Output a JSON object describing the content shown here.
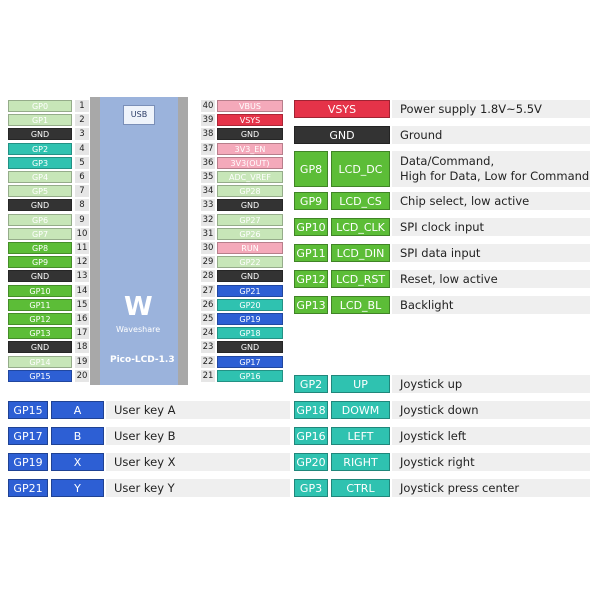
{
  "colors": {
    "lightgreen": "#c7e6b8",
    "dark": "#333333",
    "teal": "#2fc2b0",
    "green": "#5cbd37",
    "blue": "#2d5fd4",
    "pink": "#f4a9ba",
    "red": "#e53349"
  },
  "board": {
    "usb_label": "USB",
    "brand": "Waveshare",
    "model": "Pico-LCD-1.3"
  },
  "left_pins": [
    {
      "num": "1",
      "label": "GP0",
      "color": "lightgreen"
    },
    {
      "num": "2",
      "label": "GP1",
      "color": "lightgreen"
    },
    {
      "num": "3",
      "label": "GND",
      "color": "dark"
    },
    {
      "num": "4",
      "label": "GP2",
      "color": "teal"
    },
    {
      "num": "5",
      "label": "GP3",
      "color": "teal"
    },
    {
      "num": "6",
      "label": "GP4",
      "color": "lightgreen"
    },
    {
      "num": "7",
      "label": "GP5",
      "color": "lightgreen"
    },
    {
      "num": "8",
      "label": "GND",
      "color": "dark"
    },
    {
      "num": "9",
      "label": "GP6",
      "color": "lightgreen"
    },
    {
      "num": "10",
      "label": "GP7",
      "color": "lightgreen"
    },
    {
      "num": "11",
      "label": "GP8",
      "color": "green"
    },
    {
      "num": "12",
      "label": "GP9",
      "color": "green"
    },
    {
      "num": "13",
      "label": "GND",
      "color": "dark"
    },
    {
      "num": "14",
      "label": "GP10",
      "color": "green"
    },
    {
      "num": "15",
      "label": "GP11",
      "color": "green"
    },
    {
      "num": "16",
      "label": "GP12",
      "color": "green"
    },
    {
      "num": "17",
      "label": "GP13",
      "color": "green"
    },
    {
      "num": "18",
      "label": "GND",
      "color": "dark"
    },
    {
      "num": "19",
      "label": "GP14",
      "color": "lightgreen"
    },
    {
      "num": "20",
      "label": "GP15",
      "color": "blue"
    }
  ],
  "right_pins": [
    {
      "num": "40",
      "label": "VBUS",
      "color": "pink"
    },
    {
      "num": "39",
      "label": "VSYS",
      "color": "red"
    },
    {
      "num": "38",
      "label": "GND",
      "color": "dark"
    },
    {
      "num": "37",
      "label": "3V3_EN",
      "color": "pink"
    },
    {
      "num": "36",
      "label": "3V3(OUT)",
      "color": "pink"
    },
    {
      "num": "35",
      "label": "ADC_VREF",
      "color": "lightgreen"
    },
    {
      "num": "34",
      "label": "GP28",
      "color": "lightgreen"
    },
    {
      "num": "33",
      "label": "GND",
      "color": "dark"
    },
    {
      "num": "32",
      "label": "GP27",
      "color": "lightgreen"
    },
    {
      "num": "31",
      "label": "GP26",
      "color": "lightgreen"
    },
    {
      "num": "30",
      "label": "RUN",
      "color": "pink"
    },
    {
      "num": "29",
      "label": "GP22",
      "color": "lightgreen"
    },
    {
      "num": "28",
      "label": "GND",
      "color": "dark"
    },
    {
      "num": "27",
      "label": "GP21",
      "color": "blue"
    },
    {
      "num": "26",
      "label": "GP20",
      "color": "teal"
    },
    {
      "num": "25",
      "label": "GP19",
      "color": "blue"
    },
    {
      "num": "24",
      "label": "GP18",
      "color": "teal"
    },
    {
      "num": "23",
      "label": "GND",
      "color": "dark"
    },
    {
      "num": "22",
      "label": "GP17",
      "color": "blue"
    },
    {
      "num": "21",
      "label": "GP16",
      "color": "teal"
    }
  ],
  "lcd_table": [
    {
      "pin": "VSYS",
      "func": "",
      "desc": "Power supply 1.8V~5.5V",
      "color": "red"
    },
    {
      "pin": "GND",
      "func": "",
      "desc": "Ground",
      "color": "dark"
    },
    {
      "pin": "GP8",
      "func": "LCD_DC",
      "desc": "Data/Command,\nHigh for Data, Low for Command",
      "color": "green"
    },
    {
      "pin": "GP9",
      "func": "LCD_CS",
      "desc": "Chip select, low active",
      "color": "green"
    },
    {
      "pin": "GP10",
      "func": "LCD_CLK",
      "desc": "SPI clock input",
      "color": "green"
    },
    {
      "pin": "GP11",
      "func": "LCD_DIN",
      "desc": "SPI data input",
      "color": "green"
    },
    {
      "pin": "GP12",
      "func": "LCD_RST",
      "desc": "Reset, low active",
      "color": "green"
    },
    {
      "pin": "GP13",
      "func": "LCD_BL",
      "desc": "Backlight",
      "color": "green"
    }
  ],
  "joystick_table": [
    {
      "pin": "GP2",
      "func": "UP",
      "desc": "Joystick up"
    },
    {
      "pin": "GP18",
      "func": "DOWM",
      "desc": "Joystick down"
    },
    {
      "pin": "GP16",
      "func": "LEFT",
      "desc": "Joystick left"
    },
    {
      "pin": "GP20",
      "func": "RIGHT",
      "desc": "Joystick right"
    },
    {
      "pin": "GP3",
      "func": "CTRL",
      "desc": "Joystick press center"
    }
  ],
  "key_table": [
    {
      "pin": "GP15",
      "func": "A",
      "desc": "User key A"
    },
    {
      "pin": "GP17",
      "func": "B",
      "desc": "User key B"
    },
    {
      "pin": "GP19",
      "func": "X",
      "desc": "User key X"
    },
    {
      "pin": "GP21",
      "func": "Y",
      "desc": "User key Y"
    }
  ]
}
